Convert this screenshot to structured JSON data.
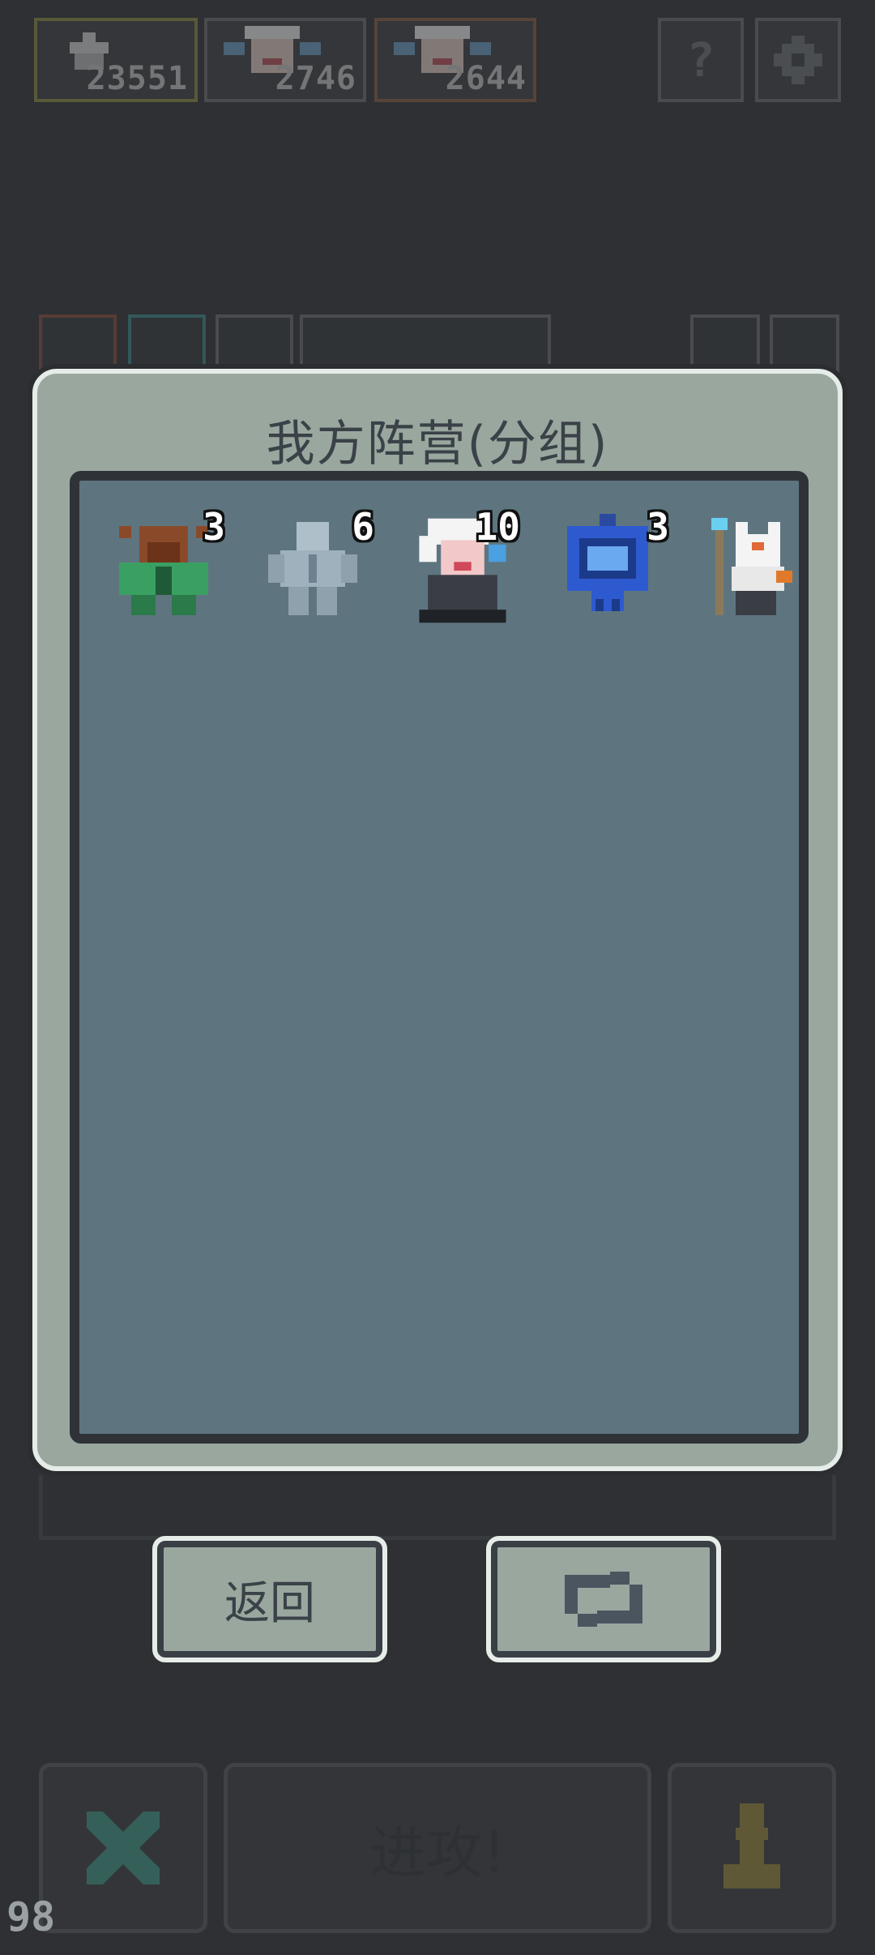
{
  "top_bar": {
    "cards": [
      {
        "value": "23551",
        "icon": "castle-icon",
        "color": "#8a8b3f"
      },
      {
        "value": "2746",
        "icon": "hero-portrait-icon",
        "color": "#6a6d6f"
      },
      {
        "value": "2644",
        "icon": "hero-portrait-icon",
        "color": "#8a5a3f"
      }
    ],
    "help_label": "?",
    "settings_icon": "gear-icon"
  },
  "modal": {
    "title": "我方阵营(分组)",
    "units": [
      {
        "name": "green-demon-icon",
        "count": "3"
      },
      {
        "name": "stone-golem-icon",
        "count": "6"
      },
      {
        "name": "white-haired-witch-icon",
        "count": "10"
      },
      {
        "name": "blue-skull-banner-icon",
        "count": "3"
      },
      {
        "name": "white-fox-shaman-icon",
        "count": ""
      }
    ]
  },
  "buttons": {
    "back_label": "返回",
    "refresh_icon": "refresh-icon"
  },
  "bottom_bar": {
    "cancel_icon": "x-icon",
    "attack_label": "进攻!",
    "pawn_icon": "pawn-icon",
    "fps": "98"
  }
}
